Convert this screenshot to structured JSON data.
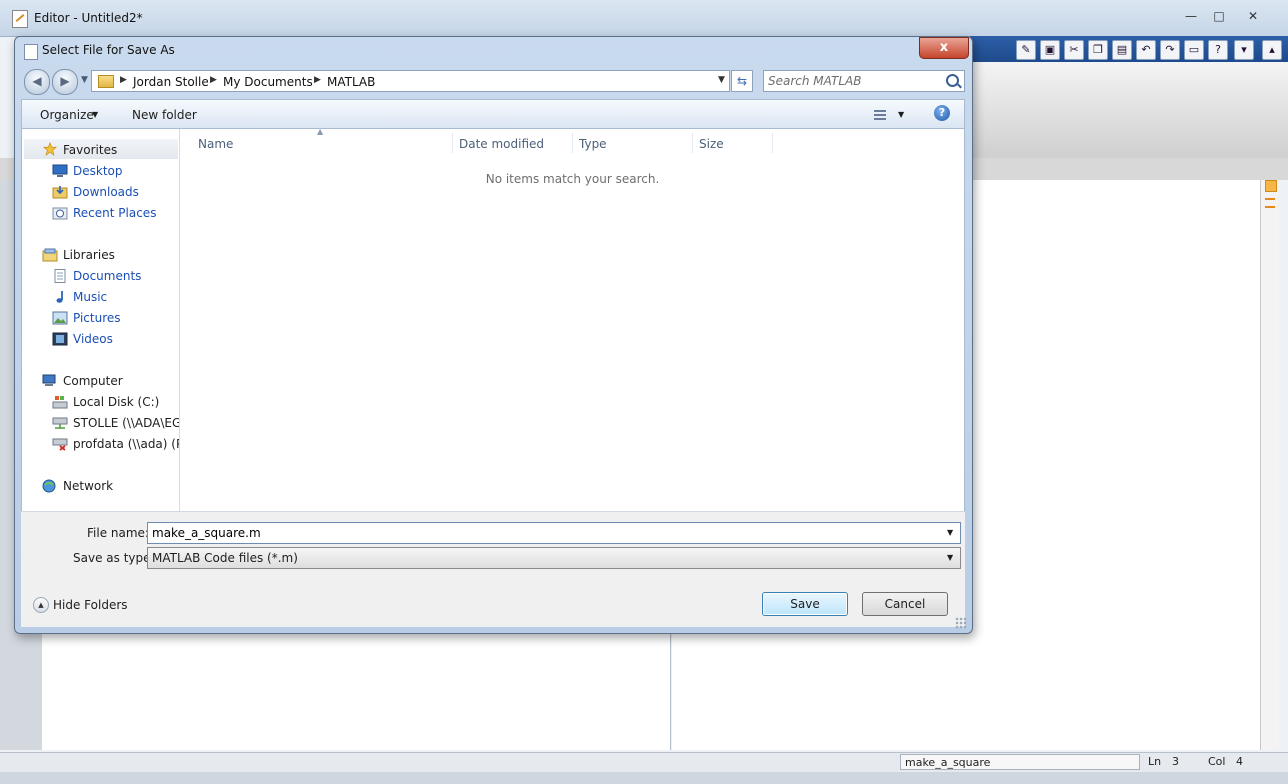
{
  "editor": {
    "title": "Editor - Untitled2*",
    "window_controls": [
      "—",
      "□",
      "✕"
    ],
    "status": {
      "function_name": "make_a_square",
      "ln_label": "Ln",
      "ln_value": "3",
      "col_label": "Col",
      "col_value": "4"
    }
  },
  "dialog": {
    "title": "Select File for Save As",
    "close_glyph": "x",
    "breadcrumbs": [
      "Jordan Stolle",
      "My Documents",
      "MATLAB"
    ],
    "search_placeholder": "Search MATLAB",
    "toolbar": {
      "organize": "Organize",
      "new_folder": "New folder"
    },
    "nav": {
      "favorites": "Favorites",
      "favorites_items": [
        "Desktop",
        "Downloads",
        "Recent Places"
      ],
      "libraries": "Libraries",
      "libraries_items": [
        "Documents",
        "Music",
        "Pictures",
        "Videos"
      ],
      "computer": "Computer",
      "computer_items": [
        "Local Disk (C:)",
        "STOLLE (\\\\ADA\\EGR",
        "profdata (\\\\ada) (P:)"
      ],
      "network": "Network"
    },
    "columns": [
      "Name",
      "Date modified",
      "Type",
      "Size"
    ],
    "empty_message": "No items match your search.",
    "form": {
      "file_name_label": "File name:",
      "file_name_value": "make_a_square.m",
      "save_type_label": "Save as type:",
      "save_type_value": "MATLAB Code files (*.m)",
      "hide_folders": "Hide Folders",
      "save": "Save",
      "cancel": "Cancel"
    }
  }
}
